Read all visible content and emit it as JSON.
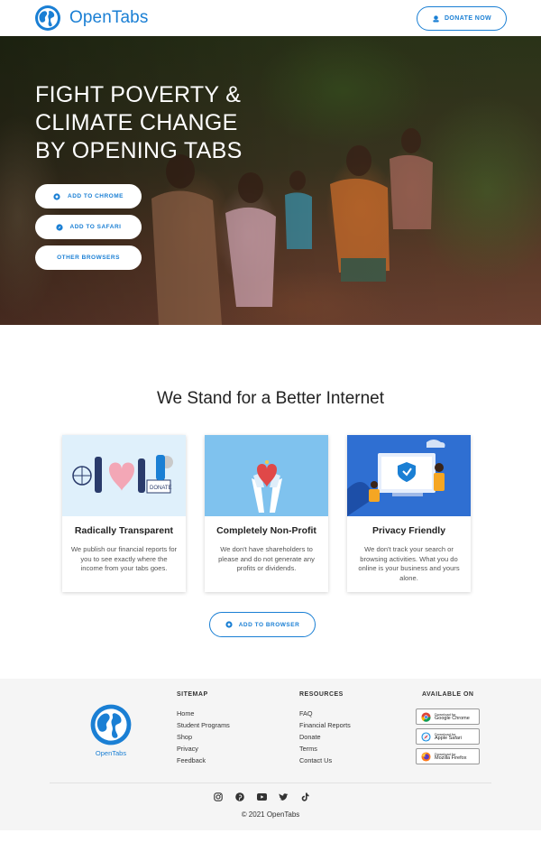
{
  "header": {
    "brand": "OpenTabs",
    "donate_label": "DONATE NOW"
  },
  "hero": {
    "title_lines": [
      "FIGHT POVERTY &",
      "CLIMATE CHANGE",
      "BY OPENING TABS"
    ],
    "buttons": [
      {
        "label": "ADD TO CHROME",
        "icon": "chrome-icon"
      },
      {
        "label": "ADD TO SAFARI",
        "icon": "safari-icon"
      },
      {
        "label": "OTHER BROWSERS",
        "icon": ""
      }
    ]
  },
  "mission": {
    "title": "We Stand for a Better Internet",
    "cards": [
      {
        "title": "Radically Transparent",
        "text": "We publish our financial reports for you to see exactly where the income from your tabs goes.",
        "donate_sign": "DONATE"
      },
      {
        "title": "Completely Non-Profit",
        "text": "We don't have shareholders to please and do not generate any profits or dividends."
      },
      {
        "title": "Privacy Friendly",
        "text": "We don't track your search or browsing activities. What you do online is your business and yours alone."
      }
    ],
    "cta_label": "ADD TO BROWSER"
  },
  "footer": {
    "brand": "OpenTabs",
    "sitemap": {
      "heading": "SITEMAP",
      "links": [
        "Home",
        "Student Programs",
        "Shop",
        "Privacy",
        "Feedback"
      ]
    },
    "resources": {
      "heading": "RESOURCES",
      "links": [
        "FAQ",
        "Financial Reports",
        "Donate",
        "Terms",
        "Contact Us"
      ]
    },
    "available": {
      "heading": "AVAILABLE ON",
      "stores": [
        {
          "small": "Download for",
          "name": "Google Chrome"
        },
        {
          "small": "Download for",
          "name": "Apple Safari"
        },
        {
          "small": "Download for",
          "name": "Mozilla Firefox"
        }
      ]
    },
    "social_icons": [
      "instagram-icon",
      "pinterest-icon",
      "youtube-icon",
      "twitter-icon",
      "tiktok-icon"
    ],
    "copyright": "© 2021 OpenTabs"
  },
  "colors": {
    "brand_blue": "#1a7fd4",
    "footer_bg": "#f5f5f5"
  }
}
